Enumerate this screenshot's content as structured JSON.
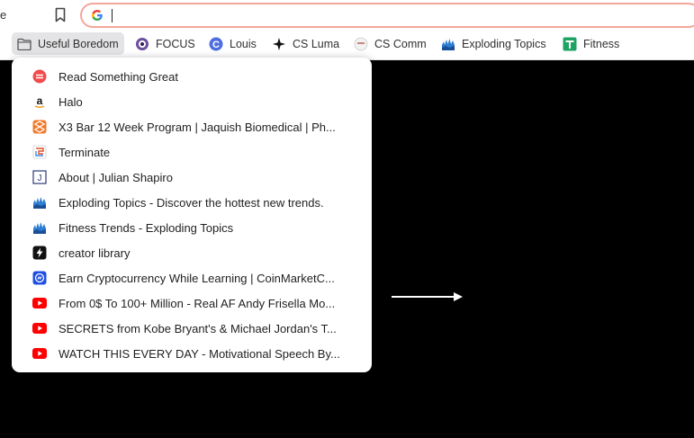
{
  "toolbar": {
    "edge_text": "e",
    "omnibox_value": ""
  },
  "bookmarks_bar": [
    {
      "label": "Useful Boredom",
      "icon": "folder-icon"
    },
    {
      "label": "FOCUS",
      "icon": "focus-icon"
    },
    {
      "label": "Louis",
      "icon": "louis-c-icon"
    },
    {
      "label": "CS Luma",
      "icon": "sparkle-icon"
    },
    {
      "label": "CS Comm",
      "icon": "comm-icon"
    },
    {
      "label": "Exploding Topics",
      "icon": "exploding-topics-icon"
    },
    {
      "label": "Fitness",
      "icon": "sheets-icon"
    }
  ],
  "dropdown": {
    "items": [
      {
        "label": "Read Something Great",
        "icon": "read-something-great-icon"
      },
      {
        "label": "Halo",
        "icon": "amazon-icon"
      },
      {
        "label": "X3 Bar 12 Week Program | Jaquish Biomedical | Ph...",
        "icon": "jaquish-icon"
      },
      {
        "label": "Terminate",
        "icon": "terminate-icon"
      },
      {
        "label": "About | Julian Shapiro",
        "icon": "julian-j-icon"
      },
      {
        "label": "Exploding Topics - Discover the hottest new trends.",
        "icon": "exploding-topics-icon"
      },
      {
        "label": "Fitness Trends - Exploding Topics",
        "icon": "exploding-topics-icon"
      },
      {
        "label": "creator library",
        "icon": "lightning-icon"
      },
      {
        "label": "Earn Cryptocurrency While Learning | CoinMarketC...",
        "icon": "coinmarketcap-icon"
      },
      {
        "label": "From 0$ To 100+ Million - Real AF Andy Frisella Mo...",
        "icon": "youtube-icon"
      },
      {
        "label": "SECRETS from Kobe Bryant's & Michael Jordan's T...",
        "icon": "youtube-icon"
      },
      {
        "label": "WATCH THIS EVERY DAY - Motivational Speech By...",
        "icon": "youtube-icon"
      }
    ]
  },
  "colors": {
    "omnibox_border": "#f4a69a",
    "youtube": "#ff0000",
    "page_background": "#000000"
  }
}
